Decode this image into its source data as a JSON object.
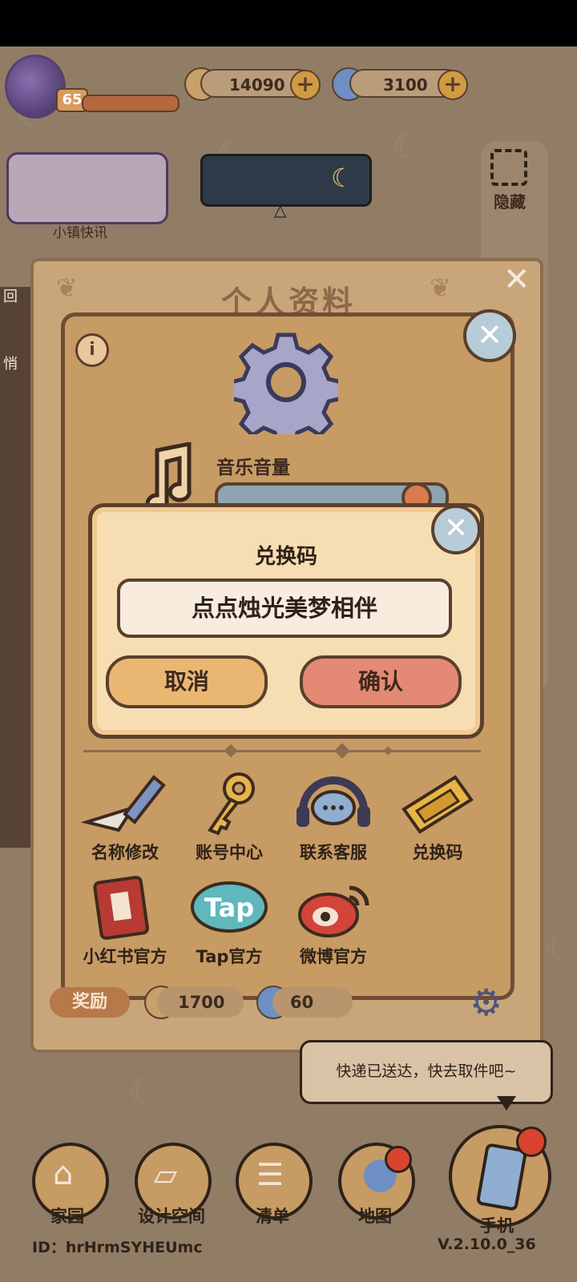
{
  "hud": {
    "level": "65",
    "coins": "14090",
    "gems": "3100",
    "plus_symbol": "+",
    "news_label": "小镇快讯",
    "hide_label": "隐藏",
    "side_label_1": "回",
    "side_label_2": "悄"
  },
  "profile": {
    "title": "个人资料",
    "close_symbol": "✕",
    "info_symbol": "i",
    "music_label": "音乐音量",
    "music_volume": 0.9,
    "grid": [
      {
        "label": "名称修改",
        "icon": "pencil-icon"
      },
      {
        "label": "账号中心",
        "icon": "key-icon"
      },
      {
        "label": "联系客服",
        "icon": "headset-icon"
      },
      {
        "label": "兑换码",
        "icon": "ticket-icon"
      },
      {
        "label": "小红书官方",
        "icon": "xiaohongshu-icon"
      },
      {
        "label": "Tap官方",
        "icon": "tap-icon"
      },
      {
        "label": "微博官方",
        "icon": "weibo-icon"
      }
    ],
    "tap_logo_text": "Tap",
    "reward": {
      "label": "奖励",
      "coins": "1700",
      "gems": "60"
    }
  },
  "redeem": {
    "title": "兑换码",
    "code_value": "点点烛光美梦相伴",
    "cancel_label": "取消",
    "confirm_label": "确认"
  },
  "bubble_text": "快递已送达，快去取件吧~",
  "nav": [
    {
      "label": "家园",
      "icon": "home-icon"
    },
    {
      "label": "设计空间",
      "icon": "design-icon"
    },
    {
      "label": "清单",
      "icon": "list-icon"
    },
    {
      "label": "地图",
      "icon": "map-pin-icon"
    },
    {
      "label": "手机",
      "icon": "phone-icon"
    }
  ],
  "footer": {
    "uid": "ID：hrHrmSYHEUmc",
    "version": "V.2.10.0_36"
  },
  "colors": {
    "panel": "#c79b64",
    "border": "#5b3f2c",
    "confirm": "#e48a74",
    "cancel": "#eab773"
  }
}
